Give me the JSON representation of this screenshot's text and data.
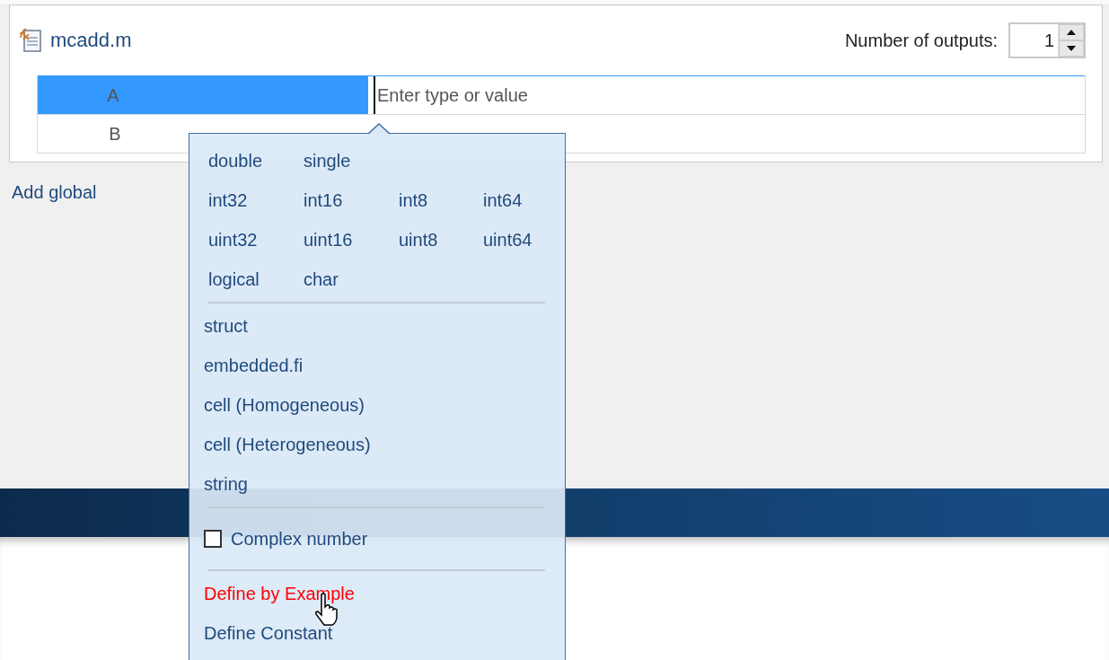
{
  "file": {
    "name": "mcadd.m"
  },
  "outputs": {
    "label": "Number of outputs:",
    "value": "1"
  },
  "inputs": [
    {
      "name": "A",
      "selected": true,
      "placeholder": "Enter type or value"
    },
    {
      "name": "B",
      "selected": false
    }
  ],
  "add_global": "Add global",
  "type_menu": {
    "sections": [
      {
        "kind": "grid",
        "rows": [
          [
            "double",
            "single"
          ],
          [
            "int32",
            "int16",
            "int8",
            "int64"
          ],
          [
            "uint32",
            "uint16",
            "uint8",
            "uint64"
          ],
          [
            "logical",
            "char"
          ]
        ]
      },
      {
        "kind": "list",
        "items": [
          {
            "label": "struct",
            "highlighted": false
          },
          {
            "label": "embedded.fi",
            "highlighted": false
          },
          {
            "label": "cell (Homogeneous)",
            "highlighted": false
          },
          {
            "label": "cell (Heterogeneous)",
            "highlighted": false
          },
          {
            "label": "string",
            "highlighted": false
          }
        ]
      },
      {
        "kind": "checkbox",
        "items": [
          {
            "label": "Complex number",
            "checked": false
          }
        ]
      },
      {
        "kind": "list",
        "items": [
          {
            "label": "Define by Example",
            "highlighted": true
          },
          {
            "label": "Define Constant",
            "highlighted": false
          }
        ]
      }
    ]
  }
}
